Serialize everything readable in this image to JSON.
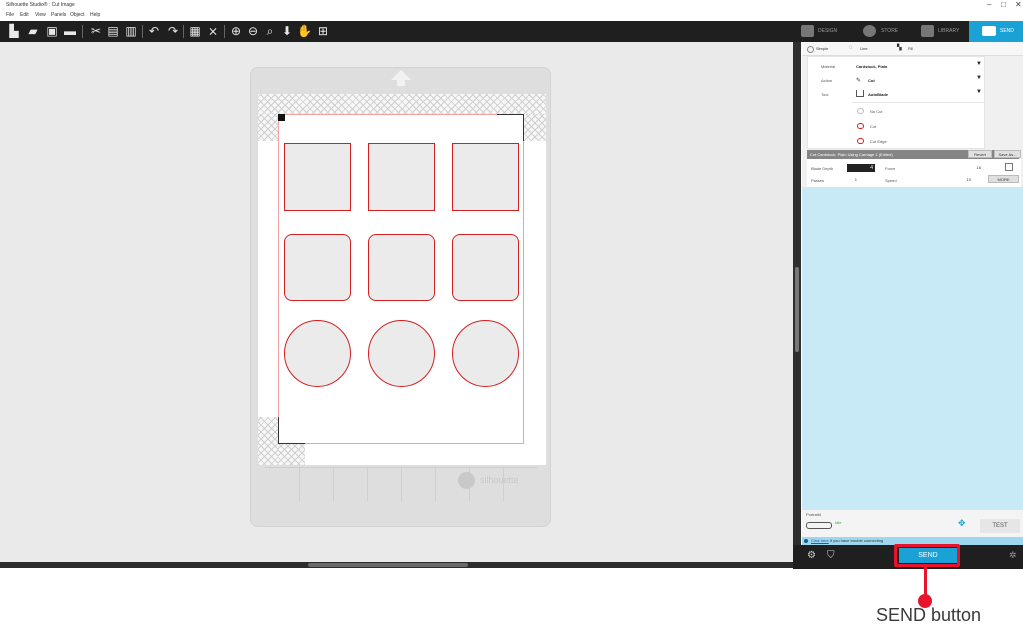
{
  "window": {
    "title": "Silhouette Studio® : Cut Image",
    "minimize": "–",
    "maximize": "□",
    "close": "✕"
  },
  "menu": [
    "File",
    "Edit",
    "View",
    "Panels",
    "Object",
    "Help"
  ],
  "toolbar_icons": [
    "new-icon",
    "open-icon",
    "save-icon",
    "print-icon",
    "cut-icon",
    "copy-icon",
    "paste-icon",
    "undo-icon",
    "redo-icon",
    "select-all-icon",
    "deselect-icon",
    "zoom-in-icon",
    "zoom-out-icon",
    "zoom-select-icon",
    "pan-down-icon",
    "hand-icon",
    "fit-to-page-icon"
  ],
  "tabs": [
    {
      "label": "DESIGN"
    },
    {
      "label": "STORE"
    },
    {
      "label": "LIBRARY"
    },
    {
      "label": "SEND"
    }
  ],
  "send_panel": {
    "modes": [
      "Simple",
      "Line",
      "Fill"
    ],
    "material_label": "Material",
    "material_value": "Cardstock, Plain",
    "action_label": "Action",
    "action_value": "Cut",
    "tool_label": "Tool",
    "tool_value": "AutoBlade",
    "line_options": [
      "No Cut",
      "Cut",
      "Cut Edge"
    ],
    "cut_bar_text": "Cut Cardstock, Plain Using Carriage 1 (Edited)",
    "revert": "Revert",
    "save_as": "Save As...",
    "blade_depth_label": "Blade Depth",
    "blade_depth_value": "4",
    "force_label": "Force",
    "force_value": "16",
    "passes_label": "Passes",
    "passes_value": "1",
    "speed_label": "Speed",
    "speed_value": "10",
    "more": "MORE",
    "device_name": "Portrait4",
    "device_status": "Idle",
    "test": "TEST",
    "trouble_link": "Click here",
    "trouble_text": "if you have trouble connecting",
    "send_label": "SEND"
  },
  "mat": {
    "logo_text": "silhouette"
  },
  "annotation": {
    "callout_text": "SEND button",
    "color": "#e8142e"
  },
  "colors": {
    "accent": "#1aa2d6",
    "cut_line": "#d21f1f",
    "toolbar": "#1f1f1f"
  }
}
